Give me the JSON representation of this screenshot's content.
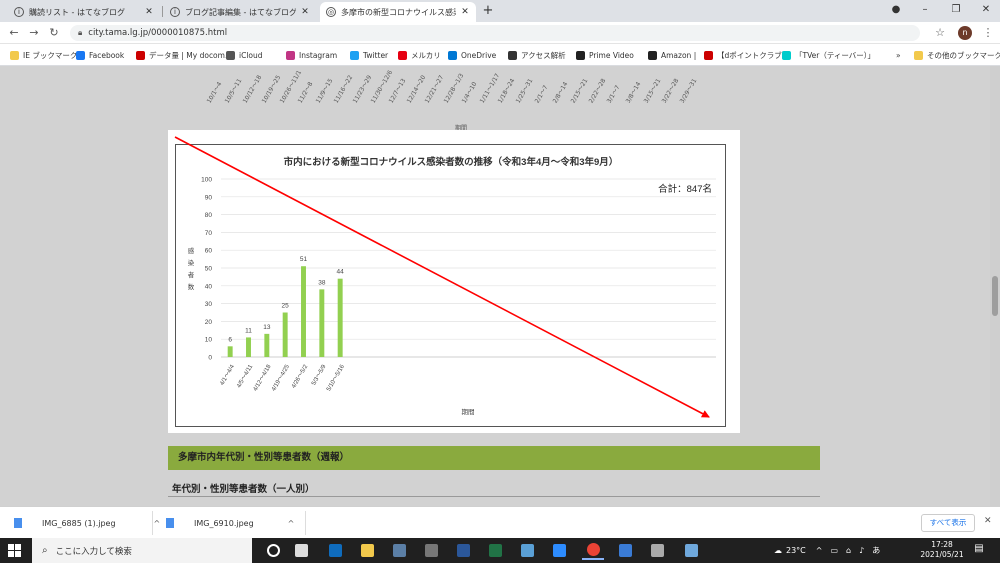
{
  "tabs": [
    {
      "title": "購読リスト - はてなブログ",
      "active": false
    },
    {
      "title": "ブログ記事編集 - はてなブログ",
      "active": false
    },
    {
      "title": "多摩市の新型コロナウイルス感染症",
      "active": true
    }
  ],
  "window_controls": {
    "minimize": "–",
    "maximize": "❐",
    "close": "✕"
  },
  "address": {
    "url": "city.tama.lg.jp/0000010875.html"
  },
  "profile_initial": "n",
  "bookmarks": [
    {
      "label": "IE ブックマーク",
      "color": "#f2c94c"
    },
    {
      "label": "Facebook",
      "color": "#1877f2"
    },
    {
      "label": "データ量 | My docom...",
      "color": "#c00"
    },
    {
      "label": "iCloud",
      "color": "#555"
    },
    {
      "label": "Instagram",
      "color": "#c13584"
    },
    {
      "label": "Twitter",
      "color": "#1da1f2"
    },
    {
      "label": "メルカリ",
      "color": "#e60012"
    },
    {
      "label": "OneDrive",
      "color": "#0078d4"
    },
    {
      "label": "アクセス解析",
      "color": "#333"
    },
    {
      "label": "Prime Video",
      "color": "#222"
    },
    {
      "label": "Amazon |",
      "color": "#222"
    },
    {
      "label": "【dポイントクラブ】",
      "color": "#c00"
    },
    {
      "label": "「TVer（ティーバー）」",
      "color": "#0cc"
    }
  ],
  "bookmarks_more": "»",
  "bookmarks_other": "その他のブックマーク",
  "top_partial_ticks": [
    "10/1～4",
    "10/5～11",
    "10/12～18",
    "10/19～25",
    "10/26～11/1",
    "11/2～8",
    "11/9～15",
    "11/16～22",
    "11/23～29",
    "11/30～12/6",
    "12/7～13",
    "12/14～20",
    "12/21～27",
    "12/28～1/3",
    "1/4～10",
    "1/11～1/17",
    "1/18～24",
    "1/25～31",
    "2/1～7",
    "2/8～14",
    "2/15～21",
    "2/22～28",
    "3/1～7",
    "3/8～14",
    "3/15～21",
    "3/22～28",
    "3/29～31"
  ],
  "top_partial_xlabel": "期間",
  "chart_data": {
    "type": "bar",
    "title": "市内における新型コロナウイルス感染者数の推移（令和3年4月～令和3年9月）",
    "total_label": "合計：847名",
    "ylabel": "感染者数",
    "xlabel": "期間",
    "ylim": [
      0,
      100
    ],
    "yticks": [
      0,
      10,
      20,
      30,
      40,
      50,
      60,
      70,
      80,
      90,
      100
    ],
    "categories": [
      "4/1～4/4",
      "4/5～4/11",
      "4/12～4/18",
      "4/19～4/25",
      "4/26～5/2",
      "5/3～5/9",
      "5/10～5/16"
    ],
    "values": [
      6,
      11,
      13,
      25,
      51,
      38,
      44
    ],
    "n_slots": 27,
    "bar_color": "#92d050",
    "grid": true
  },
  "annotation": {
    "color": "#ff0000"
  },
  "section_heading": "多摩市内年代別・性別等患者数（週報）",
  "sub_heading": "年代別・性別等患者数（一人別）",
  "downloads": [
    {
      "name": "IMG_6885 (1).jpeg"
    },
    {
      "name": "IMG_6910.jpeg"
    }
  ],
  "downloads_showall": "すべて表示",
  "taskbar": {
    "search_placeholder": "ここに入力して検索",
    "apps": [
      {
        "name": "cortana",
        "color": "#fff"
      },
      {
        "name": "taskview",
        "color": "#ddd"
      },
      {
        "name": "outlook",
        "color": "#0f6cbd"
      },
      {
        "name": "explorer",
        "color": "#f2c94c"
      },
      {
        "name": "app3",
        "color": "#5b7fa6"
      },
      {
        "name": "calculator",
        "color": "#777"
      },
      {
        "name": "word",
        "color": "#2b579a"
      },
      {
        "name": "excel",
        "color": "#217346"
      },
      {
        "name": "app7",
        "color": "#5aa0d6"
      },
      {
        "name": "zoom",
        "color": "#2d8cff"
      },
      {
        "name": "chrome",
        "color": "#ea4335"
      },
      {
        "name": "photos",
        "color": "#3a7bd5"
      },
      {
        "name": "app11",
        "color": "#aaa"
      },
      {
        "name": "app12",
        "color": "#6fa8dc"
      }
    ],
    "weather": "23°C",
    "ime": "あ",
    "time": "17:28",
    "date": "2021/05/21"
  }
}
